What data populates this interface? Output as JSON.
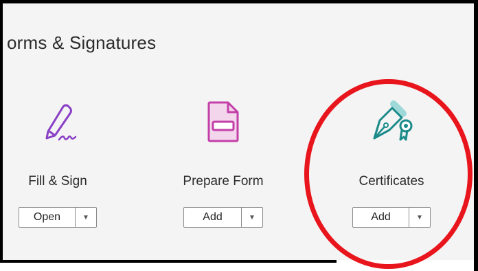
{
  "section": {
    "title": "orms & Signatures"
  },
  "tools": [
    {
      "icon": "pen-sign-icon",
      "label": "Fill & Sign",
      "button_label": "Open",
      "color": "#8a3fc7"
    },
    {
      "icon": "form-document-icon",
      "label": "Prepare Form",
      "button_label": "Add",
      "color": "#c33fa8"
    },
    {
      "icon": "certificate-pen-icon",
      "label": "Certificates",
      "button_label": "Add",
      "color": "#1a8a8a"
    }
  ],
  "highlight": {
    "color": "#e8151c"
  }
}
